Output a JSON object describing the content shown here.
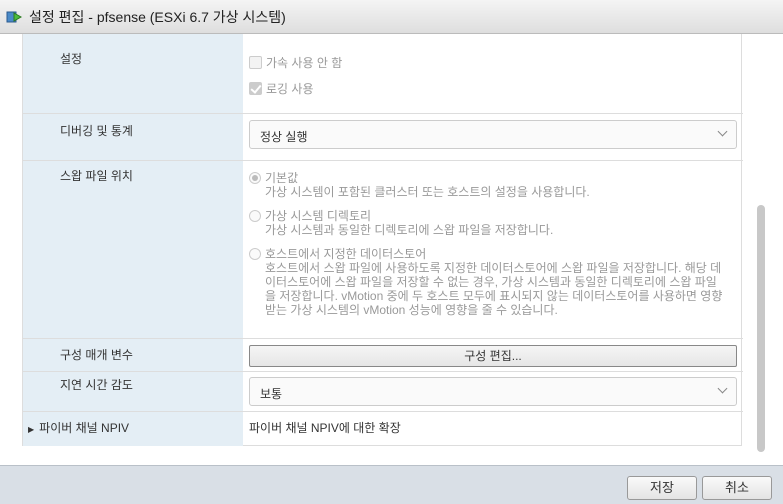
{
  "window": {
    "title": "설정 편집 - pfsense (ESXi 6.7 가상 시스템)"
  },
  "rows": {
    "settings": {
      "label": "설정",
      "disable_accel": "가속 사용 안 함",
      "enable_logging": "로깅 사용"
    },
    "debug": {
      "label": "디버깅 및 통계",
      "value": "정상 실행"
    },
    "swap": {
      "label": "스왑 파일 위치",
      "options": [
        {
          "title": "기본값",
          "desc": "가상 시스템이 포함된 클러스터 또는 호스트의 설정을 사용합니다.",
          "selected": true
        },
        {
          "title": "가상 시스템 디렉토리",
          "desc": "가상 시스템과 동일한 디렉토리에 스왑 파일을 저장합니다.",
          "selected": false
        },
        {
          "title": "호스트에서 지정한 데이터스토어",
          "desc": "호스트에서 스왑 파일에 사용하도록 지정한 데이터스토어에 스왑 파일을 저장합니다. 해당 데이터스토어에 스왑 파일을 저장할 수 없는 경우, 가상 시스템과 동일한 디렉토리에 스왑 파일을 저장합니다. vMotion 중에 두 호스트 모두에 표시되지 않는 데이터스토어를 사용하면 영향 받는 가상 시스템의 vMotion 성능에 영향을 줄 수 있습니다.",
          "selected": false
        }
      ]
    },
    "config": {
      "label": "구성 매개 변수",
      "button": "구성 편집..."
    },
    "latency": {
      "label": "지연 시간 감도",
      "value": "보통"
    },
    "npiv": {
      "label": "파이버 채널 NPIV",
      "value": "파이버 채널 NPIV에 대한 확장"
    }
  },
  "footer": {
    "save": "저장",
    "cancel": "취소"
  }
}
